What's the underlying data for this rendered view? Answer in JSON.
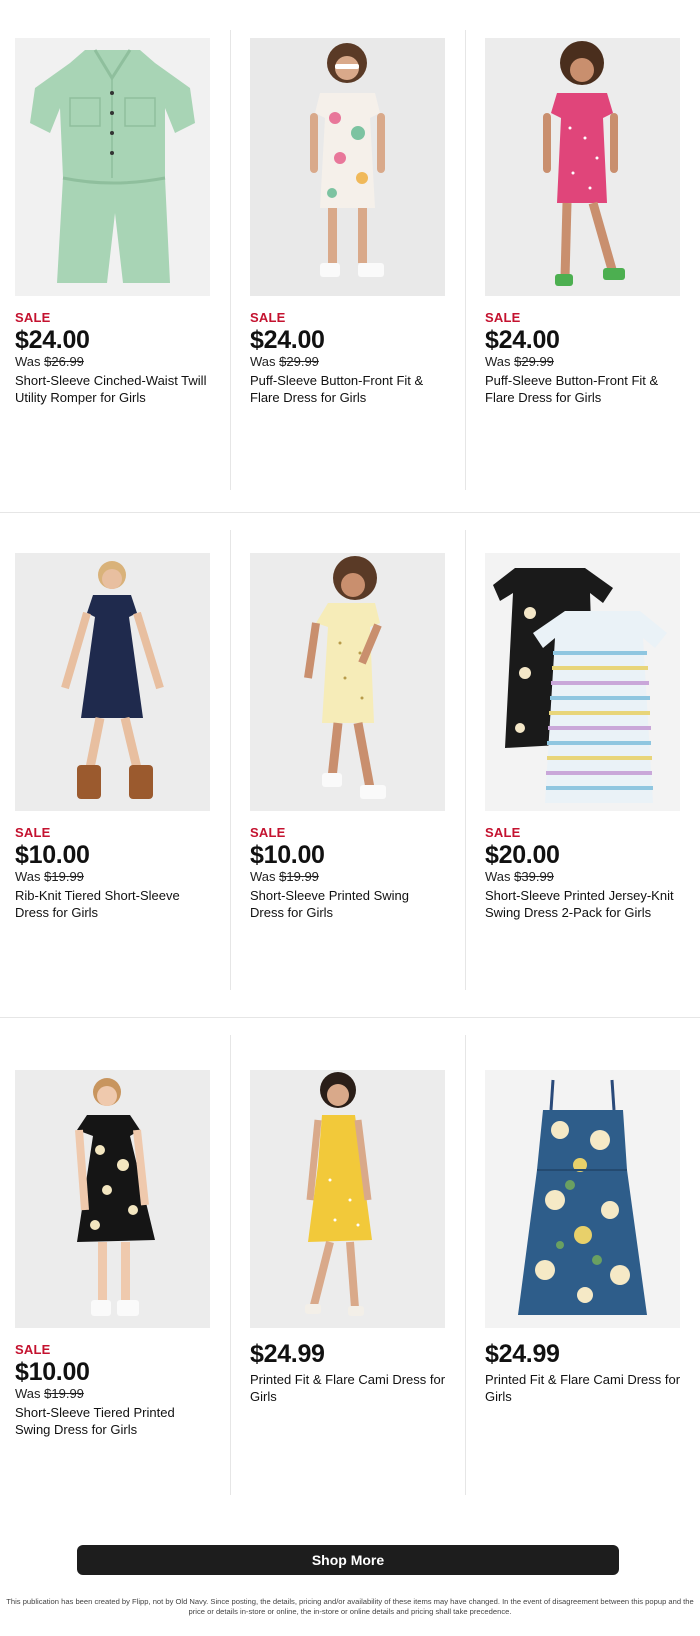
{
  "products": [
    {
      "sale_label": "SALE",
      "price": "$24.00",
      "was_prefix": "Was ",
      "was_price": "$26.99",
      "title": "Short-Sleeve Cinched-Waist Twill Utility Romper for Girls",
      "image": "mint-romper"
    },
    {
      "sale_label": "SALE",
      "price": "$24.00",
      "was_prefix": "Was ",
      "was_price": "$29.99",
      "title": "Puff-Sleeve Button-Front Fit & Flare Dress for Girls",
      "image": "girl-floral-white-dress"
    },
    {
      "sale_label": "SALE",
      "price": "$24.00",
      "was_prefix": "Was ",
      "was_price": "$29.99",
      "title": "Puff-Sleeve Button-Front Fit & Flare Dress for Girls",
      "image": "girl-pink-dress"
    },
    {
      "sale_label": "SALE",
      "price": "$10.00",
      "was_prefix": "Was ",
      "was_price": "$19.99",
      "title": "Rib-Knit Tiered Short-Sleeve Dress for Girls",
      "image": "girl-navy-dress"
    },
    {
      "sale_label": "SALE",
      "price": "$10.00",
      "was_prefix": "Was ",
      "was_price": "$19.99",
      "title": "Short-Sleeve Printed Swing Dress for Girls",
      "image": "girl-yellow-print-dress"
    },
    {
      "sale_label": "SALE",
      "price": "$20.00",
      "was_prefix": "Was ",
      "was_price": "$39.99",
      "title": "Short-Sleeve Printed Jersey-Knit Swing Dress 2-Pack for Girls",
      "image": "two-pack-dresses"
    },
    {
      "sale_label": "SALE",
      "price": "$10.00",
      "was_prefix": "Was ",
      "was_price": "$19.99",
      "title": "Short-Sleeve Tiered Printed Swing Dress for Girls",
      "image": "girl-black-floral-dress"
    },
    {
      "sale_label": "",
      "price": "$24.99",
      "was_prefix": "",
      "was_price": "",
      "title": "Printed Fit & Flare Cami Dress for Girls",
      "image": "girl-yellow-cami-dress"
    },
    {
      "sale_label": "",
      "price": "$24.99",
      "was_prefix": "",
      "was_price": "",
      "title": "Printed Fit & Flare Cami Dress for Girls",
      "image": "blue-floral-cami-dress"
    }
  ],
  "shop_more_label": "Shop More",
  "disclaimer": "This publication has been created by Flipp, not by Old Navy. Since posting, the details, pricing and/or availability of these items may have changed. In the event of disagreement between this popup and the price or details in-store or online, the in-store or online details and pricing shall take precedence.",
  "colors": {
    "sale": "#c4122f",
    "button": "#1d1d1d"
  }
}
